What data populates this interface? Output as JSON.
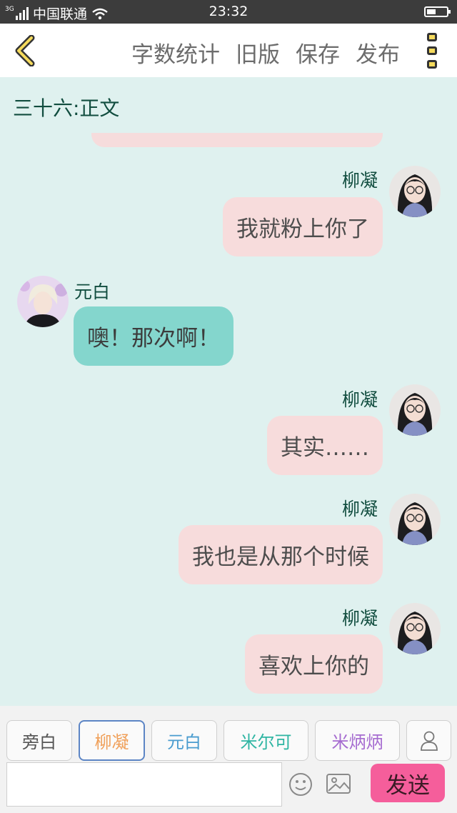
{
  "status_bar": {
    "network": "3G",
    "carrier": "中国联通",
    "time": "23:32"
  },
  "header": {
    "back_icon": "chevron-left-icon",
    "buttons": [
      "字数统计",
      "旧版",
      "保存",
      "发布"
    ],
    "menu_icon": "more-vertical-icon"
  },
  "chapter_title": "三十六:正文",
  "messages": [
    {
      "speaker": "柳凝",
      "side": "right",
      "text": "我就粉上你了",
      "color": "#f7dcdc"
    },
    {
      "speaker": "元白",
      "side": "left",
      "text": "噢！那次啊！",
      "color": "#84d6cd"
    },
    {
      "speaker": "柳凝",
      "side": "right",
      "text": "其实……",
      "color": "#f7dcdc"
    },
    {
      "speaker": "柳凝",
      "side": "right",
      "text": "我也是从那个时候",
      "color": "#f7dcdc"
    },
    {
      "speaker": "柳凝",
      "side": "right",
      "text": "喜欢上你的",
      "color": "#f7dcdc"
    }
  ],
  "characters": [
    {
      "label": "旁白",
      "color": "#555555"
    },
    {
      "label": "柳凝",
      "color": "#f0a05a"
    },
    {
      "label": "元白",
      "color": "#4a9ccf"
    },
    {
      "label": "米尔可",
      "color": "#2fb5a3"
    },
    {
      "label": "米炳炳",
      "color": "#a56bd0"
    }
  ],
  "composer": {
    "input_value": "",
    "input_placeholder": "",
    "send_label": "发送",
    "emoji_icon": "smiley-icon",
    "image_icon": "image-icon",
    "add_character_icon": "person-icon"
  },
  "colors": {
    "background": "#dff1ef",
    "accent_send": "#f55e9b",
    "narrator_bubble": "#84d6cd",
    "self_bubble": "#f7dcdc"
  }
}
